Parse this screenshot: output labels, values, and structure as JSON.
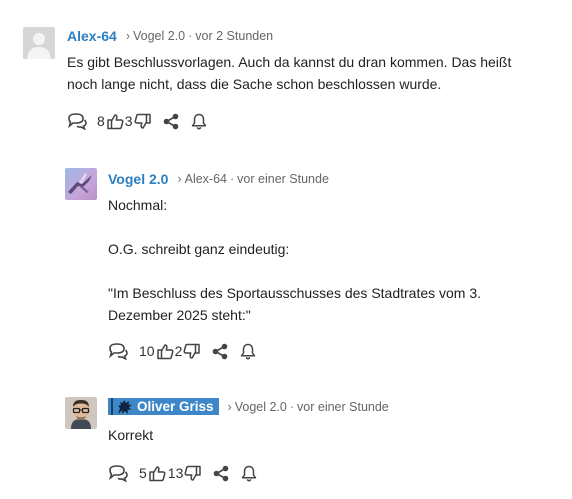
{
  "comments": [
    {
      "author": "Alex-64",
      "reply_marker": "›",
      "reply_to": "Vogel 2.0",
      "dot": "·",
      "time": "vor 2 Stunden",
      "paragraphs": [
        "Es gibt Beschlussvorlagen. Auch da kannst du dran kommen. Das heißt noch lange nicht, dass die Sache schon beschlossen wurde."
      ],
      "upvotes": "8",
      "downvotes": "3"
    },
    {
      "author": "Vogel 2.0",
      "reply_marker": "›",
      "reply_to": "Alex-64",
      "dot": "·",
      "time": "vor einer Stunde",
      "paragraphs": [
        "Nochmal:",
        "O.G. schreibt ganz eindeutig:",
        "\"Im Beschluss des Sportausschusses des Stadtrates vom 3. Dezember 2025 steht:\""
      ],
      "upvotes": "10",
      "downvotes": "2"
    },
    {
      "author": "Oliver Griss",
      "reply_marker": "›",
      "reply_to": "Vogel 2.0",
      "dot": "·",
      "time": "vor einer Stunde",
      "paragraphs": [
        "Korrekt"
      ],
      "upvotes": "5",
      "downvotes": "13"
    }
  ],
  "colors": {
    "author_link": "#2b7fc2",
    "badge_bg": "#3d87c8",
    "icon": "#444444"
  },
  "icons": [
    "reply-icon",
    "thumbs-up-icon",
    "thumbs-down-icon",
    "share-icon",
    "bell-icon"
  ]
}
